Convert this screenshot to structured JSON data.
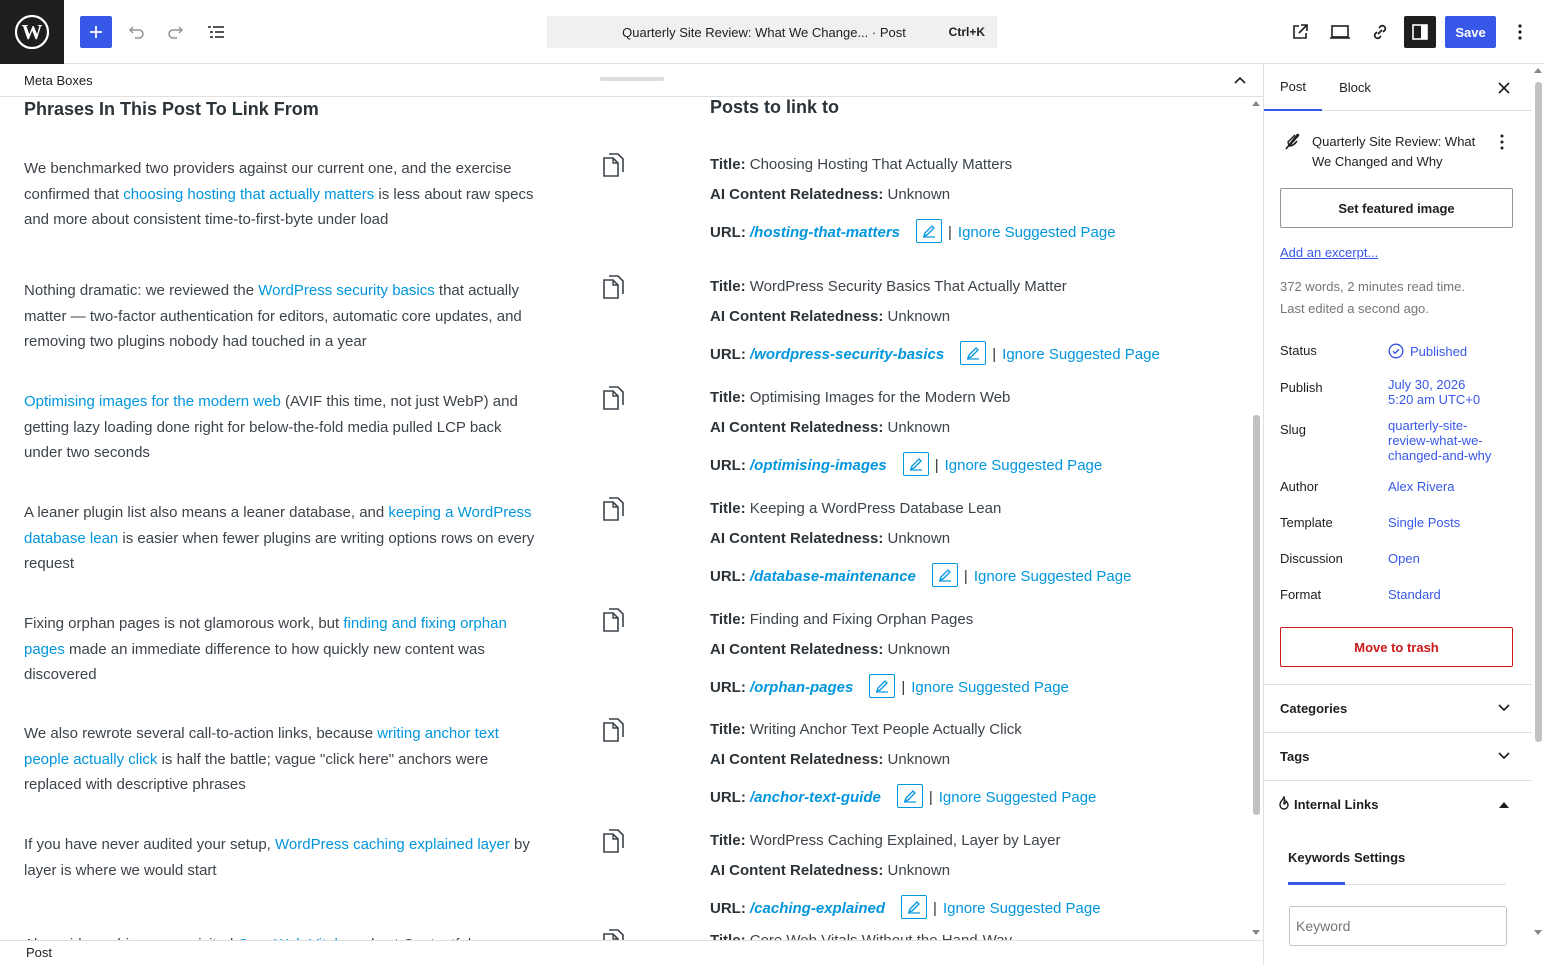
{
  "topbar": {
    "doc_title": "Quarterly Site Review: What We Change... · Post",
    "shortcut": "Ctrl+K",
    "save_label": "Save"
  },
  "meta_boxes": {
    "label": "Meta Boxes"
  },
  "main": {
    "left_heading": "Phrases In This Post To Link From",
    "right_heading": "Posts to link to",
    "title_label": "Title:",
    "relatedness_label": "AI Content Relatedness:",
    "url_label": "URL:",
    "ignore_label": "Ignore Suggested Page",
    "separator": "|",
    "rows": [
      {
        "pre": "We benchmarked two providers against our current one, and the exercise confirmed that ",
        "link": "choosing hosting that actually matters",
        "post": " is less about raw specs and more about consistent time-to-first-byte under load",
        "title": "Choosing Hosting That Actually Matters",
        "relatedness": "Unknown",
        "url": "/hosting-that-matters"
      },
      {
        "pre": "Nothing dramatic: we reviewed the ",
        "link": "WordPress security basics",
        "post": " that actually matter — two-factor authentication for editors, automatic core updates, and removing two plugins nobody had touched in a year",
        "title": "WordPress Security Basics That Actually Matter",
        "relatedness": "Unknown",
        "url": "/wordpress-security-basics"
      },
      {
        "pre": "",
        "link": "Optimising images for the modern web",
        "post": " (AVIF this time, not just WebP) and getting lazy loading done right for below-the-fold media pulled LCP back under two seconds",
        "title": "Optimising Images for the Modern Web",
        "relatedness": "Unknown",
        "url": "/optimising-images"
      },
      {
        "pre": "A leaner plugin list also means a leaner database, and ",
        "link": "keeping a WordPress database lean",
        "post": " is easier when fewer plugins are writing options rows on every request",
        "title": "Keeping a WordPress Database Lean",
        "relatedness": "Unknown",
        "url": "/database-maintenance"
      },
      {
        "pre": "Fixing orphan pages is not glamorous work, but ",
        "link": "finding and fixing orphan pages",
        "post": " made an immediate difference to how quickly new content was discovered",
        "title": "Finding and Fixing Orphan Pages",
        "relatedness": "Unknown",
        "url": "/orphan-pages"
      },
      {
        "pre": "We also rewrote several call-to-action links, because ",
        "link": "writing anchor text people actually click",
        "post": " is half the battle; vague \"click here\" anchors were replaced with descriptive phrases",
        "title": "Writing Anchor Text People Actually Click",
        "relatedness": "Unknown",
        "url": "/anchor-text-guide"
      },
      {
        "pre": "If you have never audited your setup, ",
        "link": "WordPress caching explained layer",
        "post": " by layer is where we would start",
        "title": "WordPress Caching Explained, Layer by Layer",
        "relatedness": "Unknown",
        "url": "/caching-explained"
      },
      {
        "pre": "Alongside caching, we revisited ",
        "link": "Core Web Vitals",
        "post": " and set Contentful",
        "title": "Core Web Vitals Without the Hand-Wav",
        "relatedness": "Unknown",
        "url": ""
      }
    ]
  },
  "footer": {
    "label": "Post"
  },
  "sidebar": {
    "tabs": {
      "post": "Post",
      "block": "Block"
    },
    "post_title": "Quarterly Site Review: What We Changed and Why",
    "featured_image": "Set featured image",
    "excerpt": "Add an excerpt...",
    "word_count": "372 words, 2 minutes read time.",
    "last_edited": "Last edited a second ago.",
    "fields": {
      "status_label": "Status",
      "status_value": "Published",
      "publish_label": "Publish",
      "publish_date": "July 30, 2026",
      "publish_time": "5:20 am UTC+0",
      "slug_label": "Slug",
      "slug_value": "quarterly-site-review-what-we-changed-and-why",
      "author_label": "Author",
      "author_value": "Alex Rivera",
      "template_label": "Template",
      "template_value": "Single Posts",
      "discussion_label": "Discussion",
      "discussion_value": "Open",
      "format_label": "Format",
      "format_value": "Standard"
    },
    "trash": "Move to trash",
    "panels": {
      "categories": "Categories",
      "tags": "Tags",
      "internal_links": "Internal Links"
    },
    "internal_links": {
      "tab_keywords": "Keywords",
      "tab_settings": "Settings",
      "keyword_placeholder": "Keyword"
    }
  },
  "colors": {
    "accent": "#3858e9",
    "link": "#0096dd",
    "danger": "#cc1818"
  }
}
